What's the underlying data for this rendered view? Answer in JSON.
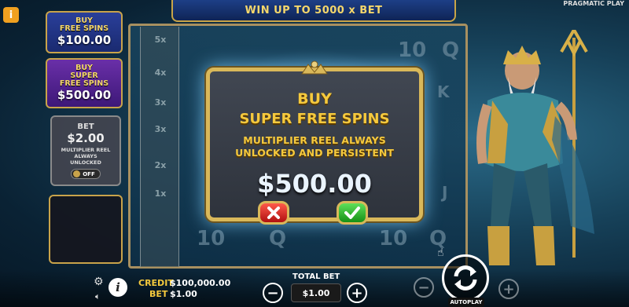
{
  "header": {
    "banner_text": "WIN UP TO 5000 x BET",
    "provider": "PRAGMATIC PLAY",
    "top_info_icon": "info-icon"
  },
  "side": {
    "buy_free_spins": {
      "line1": "BUY",
      "line2": "FREE SPINS",
      "price": "$100.00"
    },
    "buy_super_free_spins": {
      "line1": "BUY",
      "line2": "SUPER",
      "line3": "FREE SPINS",
      "price": "$500.00"
    },
    "bet_panel": {
      "label": "BET",
      "value": "$2.00",
      "desc1": "MULTIPLIER REEL",
      "desc2": "ALWAYS",
      "desc3": "UNLOCKED",
      "toggle": "OFF"
    }
  },
  "grid": {
    "multipliers": [
      "5x",
      "4x",
      "3x",
      "3x",
      "2x",
      "1x"
    ],
    "symbols": [
      "10",
      "Q",
      "10",
      "Q",
      "10",
      "Q",
      "K",
      "J"
    ]
  },
  "modal": {
    "title1": "BUY",
    "title2": "SUPER FREE SPINS",
    "desc1": "MULTIPLIER REEL ALWAYS",
    "desc2": "UNLOCKED AND PERSISTENT",
    "price": "$500.00",
    "cancel_icon": "close-icon",
    "confirm_icon": "check-icon"
  },
  "bottom": {
    "credit_label": "CREDIT",
    "credit_value": "$100,000.00",
    "bet_label": "BET",
    "bet_value": "$1.00",
    "total_bet_label": "TOTAL BET",
    "total_bet_value": "$1.00",
    "minus": "−",
    "plus": "+",
    "autoplay_label": "AUTOPLAY"
  },
  "colors": {
    "gold": "#d9b85a",
    "accent_text": "#f5c93d",
    "cancel": "#d02020",
    "confirm": "#2cb82c"
  }
}
